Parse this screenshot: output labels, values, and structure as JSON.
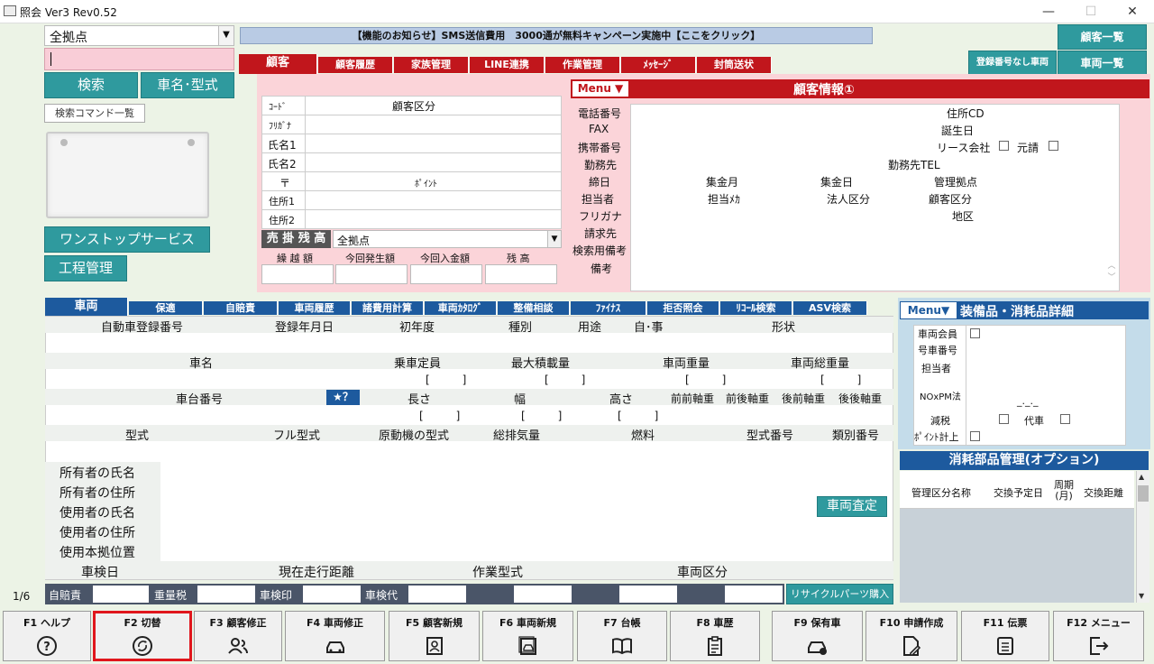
{
  "window": {
    "title": "照会 Ver3 Rev0.52",
    "minimize": "—",
    "maximize": "☐",
    "close": "✕"
  },
  "location_select": {
    "value": "全拠点"
  },
  "search": {
    "button": "検索",
    "car_button": "車名･型式",
    "commands": "検索コマンド一覧"
  },
  "notice": "【機能のお知らせ】SMS送信費用　3000通が無料キャンペーン実施中【ここをクリック】",
  "right_buttons": {
    "customer_list": "顧客一覧",
    "no_reg": "登録番号なし車両",
    "vehicle_list": "車両一覧"
  },
  "left_buttons": {
    "onestop": "ワンストップサービス",
    "process": "工程管理"
  },
  "customer_tabs": [
    "顧客",
    "顧客履歴",
    "家族管理",
    "LINE連携",
    "作業管理",
    "ﾒｯｾｰｼﾞ",
    "封筒送状"
  ],
  "cust_left": {
    "code": "ｺｰﾄﾞ",
    "class": "顧客区分",
    "kana": "ﾌﾘｶﾞﾅ",
    "name1": "氏名1",
    "name2": "氏名2",
    "zip": "〒",
    "point": "ﾎﾟｲﾝﾄ",
    "addr1": "住所1",
    "addr2": "住所2",
    "receivable": "売 掛 残 高",
    "recv_loc": "全拠点",
    "carry": "繰 越 額",
    "occur": "今回発生額",
    "paid": "今回入金額",
    "balance": "残 高"
  },
  "cust_info": {
    "menu": "Menu ▼",
    "title": "顧客情報①",
    "phone": "電話番号",
    "addr_cd": "住所CD",
    "fax": "FAX",
    "birthday": "誕生日",
    "mobile": "携帯番号",
    "lease": "リース会社",
    "motouke": "元請",
    "work": "勤務先",
    "work_tel": "勤務先TEL",
    "close_day": "締日",
    "collect_month": "集金月",
    "collect_day": "集金日",
    "base": "管理拠点",
    "staff": "担当者",
    "maker": "担当ﾒｶ",
    "corp": "法人区分",
    "cust_class": "顧客区分",
    "kana": "フリガナ",
    "area": "地区",
    "bill": "請求先",
    "search_note": "検索用備考",
    "note": "備考"
  },
  "vehicle_tabs": [
    "車両",
    "保適",
    "自賠責",
    "車両履歴",
    "諸費用計算",
    "車両ｶﾀﾛｸﾞ",
    "整備相談",
    "ﾌｧｲﾅｽ",
    "拒否照会",
    "ﾘｺｰﾙ検索",
    "ASV検索"
  ],
  "vehicle": {
    "reg_no": "自動車登録番号",
    "reg_date": "登録年月日",
    "first_year": "初年度",
    "type": "種別",
    "use": "用途",
    "self": "自･事",
    "shape": "形状",
    "car_name": "車名",
    "capacity": "乗車定員",
    "max_load": "最大積載量",
    "weight": "車両重量",
    "gross": "車両総重量",
    "chassis": "車台番号",
    "star": "★？",
    "length": "長さ",
    "width": "幅",
    "height": "高さ",
    "ff_axle": "前前軸重",
    "fr_axle": "前後軸重",
    "rf_axle": "後前軸重",
    "rr_axle": "後後軸重",
    "model": "型式",
    "full_model": "フル型式",
    "engine": "原動機の型式",
    "displacement": "総排気量",
    "fuel": "燃料",
    "model_no": "型式番号",
    "class_no": "類別番号",
    "owner_name": "所有者の氏名",
    "owner_addr": "所有者の住所",
    "user_name": "使用者の氏名",
    "user_addr": "使用者の住所",
    "base_loc": "使用本拠位置",
    "appraisal": "車両査定",
    "inspection": "車検日",
    "mileage": "現在走行距離",
    "work_type": "作業型式",
    "veh_class": "車両区分",
    "bracket": "[　　　]"
  },
  "fees": {
    "jibaiseki": "自賠責",
    "weight_tax": "重量税",
    "stamp": "車検印",
    "inspection_fee": "車検代",
    "recycle": "リサイクルパーツ購入"
  },
  "equipment": {
    "menu": "Menu▼",
    "title": "装備品・消耗品詳細",
    "member": "車両会員",
    "car_no": "号車番号",
    "staff": "担当者",
    "nox": "NOxPM法",
    "tax_cut": "減税",
    "substitute": "代車",
    "point_add": "ﾎﾟｲﾝﾄ計上",
    "date_ph": "_._._"
  },
  "consumables": {
    "title": "消耗部品管理(オプション)",
    "col1": "管理区分名称",
    "col2": "交換予定日",
    "col3": "周期(月)",
    "col4": "交換距離"
  },
  "page_indicator": "1/6",
  "fkeys": [
    {
      "label": "F1 ヘルプ",
      "icon": "help-icon"
    },
    {
      "label": "F2 切替",
      "icon": "switch-icon"
    },
    {
      "label": "F3 顧客修正",
      "icon": "customer-edit-icon"
    },
    {
      "label": "F4 車両修正",
      "icon": "vehicle-edit-icon"
    },
    {
      "label": "F5 顧客新規",
      "icon": "customer-new-icon"
    },
    {
      "label": "F6 車両新規",
      "icon": "vehicle-new-icon"
    },
    {
      "label": "F7 台帳",
      "icon": "ledger-icon"
    },
    {
      "label": "F8 車歴",
      "icon": "history-icon"
    },
    {
      "label": "F9 保有車",
      "icon": "owned-car-icon"
    },
    {
      "label": "F10 申請作成",
      "icon": "application-icon"
    },
    {
      "label": "F11 伝票",
      "icon": "slip-icon"
    },
    {
      "label": "F12 メニュー",
      "icon": "exit-icon"
    }
  ]
}
